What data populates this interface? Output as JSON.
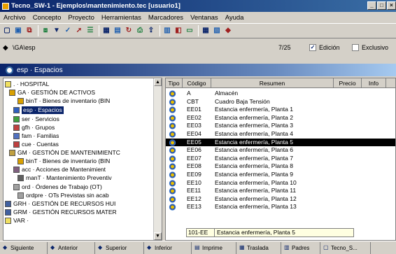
{
  "window": {
    "title": "Tecno_SW-1 - Ejemplos\\mantenimiento.tec  [usuario1]"
  },
  "menu": [
    "Archivo",
    "Concepto",
    "Proyecto",
    "Herramientas",
    "Marcadores",
    "Ventanas",
    "Ayuda"
  ],
  "toolbar_icons": [
    "new-icon",
    "open-icon",
    "copy-icon",
    "paste-icon",
    "filter-icon",
    "check-icon",
    "arrow-icon",
    "tree-icon",
    "grid-icon",
    "form-icon",
    "refresh-icon",
    "print-icon",
    "export-icon",
    "chart-icon",
    "lock-icon",
    "window-icon",
    "tile-icon",
    "cascade-icon",
    "help-icon"
  ],
  "pathbar": {
    "path": "\\GA\\esp",
    "count": "7/25",
    "edit_label": "Edición",
    "edit_checked": true,
    "exclusive_label": "Exclusivo",
    "exclusive_checked": false
  },
  "header": {
    "title": "esp · Espacios"
  },
  "tree": [
    {
      "label": ". · HOSPITAL",
      "color": "#f0e060"
    },
    {
      "label": "GA · GESTIÓN DE ACTIVOS",
      "color": "#d9a000"
    },
    {
      "label": "binT · Bienes de inventario (BIN",
      "color": "#d9a000"
    },
    {
      "label": "esp · Espacios",
      "color": "#3060c0",
      "selected": true
    },
    {
      "label": "ser · Servicios",
      "color": "#40a040"
    },
    {
      "label": "gfh · Grupos",
      "color": "#c04040"
    },
    {
      "label": "fam · Familias",
      "color": "#5070c0"
    },
    {
      "label": "cue · Cuentas",
      "color": "#c04040"
    },
    {
      "label": "GM · GESTIÓN DE MANTENIMIENTC",
      "color": "#c0a040"
    },
    {
      "label": "binT · Bienes de inventario (BIN",
      "color": "#d9a000"
    },
    {
      "label": "acc · Acciones de Mantenimient",
      "color": "#806080"
    },
    {
      "label": "manT · Mantenimiento Preventiv",
      "color": "#606060"
    },
    {
      "label": "ord · Órdenes de Trabajo (OT)",
      "color": "#a0a0a0"
    },
    {
      "label": "ordpre · OTs Previstas sin acab",
      "color": "#a0a0a0"
    },
    {
      "label": "GRH · GESTIÓN DE RECURSOS HUI",
      "color": "#4060a0"
    },
    {
      "label": "GRM · GESTIÓN RECURSOS MATER",
      "color": "#4060a0"
    },
    {
      "label": "VAR ·",
      "color": "#f0e060"
    }
  ],
  "grid": {
    "columns": [
      "Tipo",
      "Código",
      "Resumen",
      "Precio",
      "Info"
    ],
    "rows": [
      {
        "code": "A",
        "summary": "Almacén"
      },
      {
        "code": "CBT",
        "summary": "Cuadro Baja Tensión"
      },
      {
        "code": "EE01",
        "summary": "Estancia enfermería, Planta 1"
      },
      {
        "code": "EE02",
        "summary": "Estancia enfermería, Planta 2"
      },
      {
        "code": "EE03",
        "summary": "Estancia enfermería, Planta 3"
      },
      {
        "code": "EE04",
        "summary": "Estancia enfermería, Planta 4"
      },
      {
        "code": "EE05",
        "summary": "Estancia enfermería, Planta 5",
        "selected": true
      },
      {
        "code": "EE06",
        "summary": "Estancia enfermería, Planta 6"
      },
      {
        "code": "EE07",
        "summary": "Estancia enfermería, Planta 7"
      },
      {
        "code": "EE08",
        "summary": "Estancia enfermería, Planta 8"
      },
      {
        "code": "EE09",
        "summary": "Estancia enfermería, Planta 9"
      },
      {
        "code": "EE10",
        "summary": "Estancia enfermería, Planta 10"
      },
      {
        "code": "EE11",
        "summary": "Estancia enfermería, Planta 11"
      },
      {
        "code": "EE12",
        "summary": "Estancia enfermería, Planta 12"
      },
      {
        "code": "EE13",
        "summary": "Estancia enfermería, Planta 13"
      }
    ]
  },
  "edit_row": {
    "code": "101-EE",
    "summary": "Estancia enfermería, Planta 5"
  },
  "bottom": [
    "Siguiente",
    "Anterior",
    "Superior",
    "Inferior",
    "Imprime",
    "Traslada",
    "Padres",
    "Tecno_S..."
  ]
}
